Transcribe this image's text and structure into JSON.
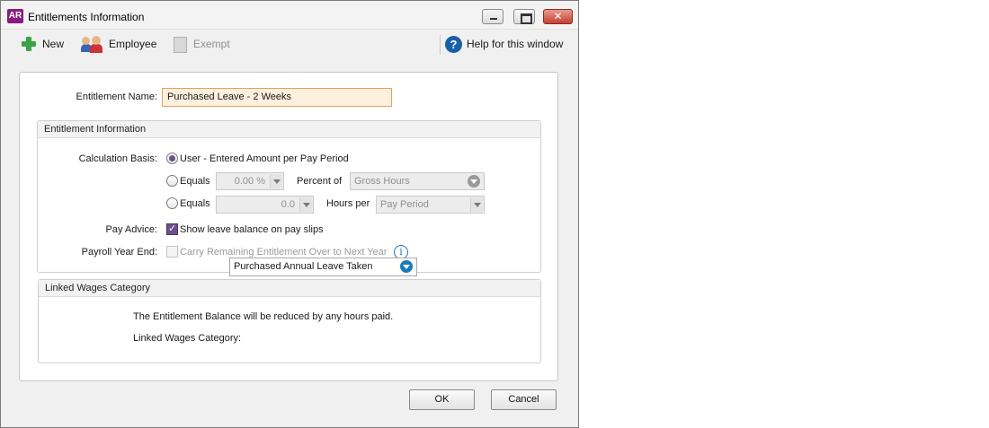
{
  "window": {
    "logo": "AR",
    "title": "Entitlements Information"
  },
  "toolbar": {
    "new_label": "New",
    "employee_label": "Employee",
    "exempt_label": "Exempt",
    "help_label": "Help for this window"
  },
  "form": {
    "entitlement_name_label": "Entitlement Name:",
    "entitlement_name_value": "Purchased Leave - 2 Weeks"
  },
  "entitlement_info": {
    "title": "Entitlement Information",
    "calc_basis_label": "Calculation Basis:",
    "option_user": "User - Entered Amount per Pay Period",
    "option_equals_1": "Equals",
    "percent_value": "0.00 %",
    "percent_of_label": "Percent of",
    "percent_of_value": "Gross Hours",
    "option_equals_2": "Equals",
    "hours_value": "0.0",
    "hours_per_label": "Hours per",
    "hours_per_value": "Pay Period",
    "pay_advice_label": "Pay Advice:",
    "pay_advice_checkbox": "Show leave balance on pay slips",
    "payroll_year_end_label": "Payroll Year End:",
    "carry_over_checkbox": "Carry Remaining Entitlement Over to Next Year",
    "info_glyph": "i"
  },
  "linked_wages": {
    "title": "Linked Wages Category",
    "note": "The Entitlement Balance will be reduced by any hours paid.",
    "category_label": "Linked Wages Category:",
    "category_value": "Purchased Annual Leave Taken"
  },
  "buttons": {
    "ok": "OK",
    "cancel": "Cancel"
  },
  "colors": {
    "accent_purple": "#6b4f8a",
    "name_field_bg": "#fdf0de",
    "name_field_border": "#e4a25a",
    "help_blue": "#1a5fa8"
  }
}
